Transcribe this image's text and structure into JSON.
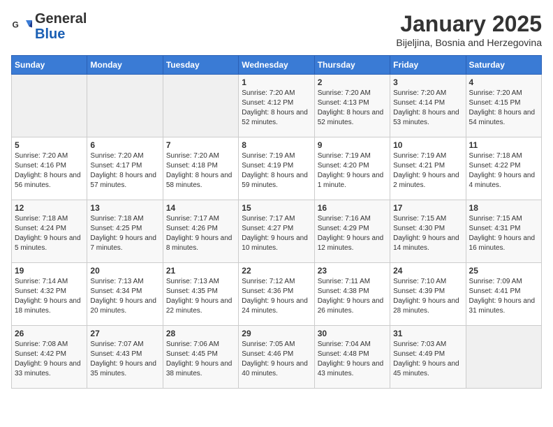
{
  "header": {
    "logo_general": "General",
    "logo_blue": "Blue",
    "month_title": "January 2025",
    "subtitle": "Bijeljina, Bosnia and Herzegovina"
  },
  "weekdays": [
    "Sunday",
    "Monday",
    "Tuesday",
    "Wednesday",
    "Thursday",
    "Friday",
    "Saturday"
  ],
  "weeks": [
    [
      {
        "day": "",
        "info": ""
      },
      {
        "day": "",
        "info": ""
      },
      {
        "day": "",
        "info": ""
      },
      {
        "day": "1",
        "info": "Sunrise: 7:20 AM\nSunset: 4:12 PM\nDaylight: 8 hours and 52 minutes."
      },
      {
        "day": "2",
        "info": "Sunrise: 7:20 AM\nSunset: 4:13 PM\nDaylight: 8 hours and 52 minutes."
      },
      {
        "day": "3",
        "info": "Sunrise: 7:20 AM\nSunset: 4:14 PM\nDaylight: 8 hours and 53 minutes."
      },
      {
        "day": "4",
        "info": "Sunrise: 7:20 AM\nSunset: 4:15 PM\nDaylight: 8 hours and 54 minutes."
      }
    ],
    [
      {
        "day": "5",
        "info": "Sunrise: 7:20 AM\nSunset: 4:16 PM\nDaylight: 8 hours and 56 minutes."
      },
      {
        "day": "6",
        "info": "Sunrise: 7:20 AM\nSunset: 4:17 PM\nDaylight: 8 hours and 57 minutes."
      },
      {
        "day": "7",
        "info": "Sunrise: 7:20 AM\nSunset: 4:18 PM\nDaylight: 8 hours and 58 minutes."
      },
      {
        "day": "8",
        "info": "Sunrise: 7:19 AM\nSunset: 4:19 PM\nDaylight: 8 hours and 59 minutes."
      },
      {
        "day": "9",
        "info": "Sunrise: 7:19 AM\nSunset: 4:20 PM\nDaylight: 9 hours and 1 minute."
      },
      {
        "day": "10",
        "info": "Sunrise: 7:19 AM\nSunset: 4:21 PM\nDaylight: 9 hours and 2 minutes."
      },
      {
        "day": "11",
        "info": "Sunrise: 7:18 AM\nSunset: 4:22 PM\nDaylight: 9 hours and 4 minutes."
      }
    ],
    [
      {
        "day": "12",
        "info": "Sunrise: 7:18 AM\nSunset: 4:24 PM\nDaylight: 9 hours and 5 minutes."
      },
      {
        "day": "13",
        "info": "Sunrise: 7:18 AM\nSunset: 4:25 PM\nDaylight: 9 hours and 7 minutes."
      },
      {
        "day": "14",
        "info": "Sunrise: 7:17 AM\nSunset: 4:26 PM\nDaylight: 9 hours and 8 minutes."
      },
      {
        "day": "15",
        "info": "Sunrise: 7:17 AM\nSunset: 4:27 PM\nDaylight: 9 hours and 10 minutes."
      },
      {
        "day": "16",
        "info": "Sunrise: 7:16 AM\nSunset: 4:29 PM\nDaylight: 9 hours and 12 minutes."
      },
      {
        "day": "17",
        "info": "Sunrise: 7:15 AM\nSunset: 4:30 PM\nDaylight: 9 hours and 14 minutes."
      },
      {
        "day": "18",
        "info": "Sunrise: 7:15 AM\nSunset: 4:31 PM\nDaylight: 9 hours and 16 minutes."
      }
    ],
    [
      {
        "day": "19",
        "info": "Sunrise: 7:14 AM\nSunset: 4:32 PM\nDaylight: 9 hours and 18 minutes."
      },
      {
        "day": "20",
        "info": "Sunrise: 7:13 AM\nSunset: 4:34 PM\nDaylight: 9 hours and 20 minutes."
      },
      {
        "day": "21",
        "info": "Sunrise: 7:13 AM\nSunset: 4:35 PM\nDaylight: 9 hours and 22 minutes."
      },
      {
        "day": "22",
        "info": "Sunrise: 7:12 AM\nSunset: 4:36 PM\nDaylight: 9 hours and 24 minutes."
      },
      {
        "day": "23",
        "info": "Sunrise: 7:11 AM\nSunset: 4:38 PM\nDaylight: 9 hours and 26 minutes."
      },
      {
        "day": "24",
        "info": "Sunrise: 7:10 AM\nSunset: 4:39 PM\nDaylight: 9 hours and 28 minutes."
      },
      {
        "day": "25",
        "info": "Sunrise: 7:09 AM\nSunset: 4:41 PM\nDaylight: 9 hours and 31 minutes."
      }
    ],
    [
      {
        "day": "26",
        "info": "Sunrise: 7:08 AM\nSunset: 4:42 PM\nDaylight: 9 hours and 33 minutes."
      },
      {
        "day": "27",
        "info": "Sunrise: 7:07 AM\nSunset: 4:43 PM\nDaylight: 9 hours and 35 minutes."
      },
      {
        "day": "28",
        "info": "Sunrise: 7:06 AM\nSunset: 4:45 PM\nDaylight: 9 hours and 38 minutes."
      },
      {
        "day": "29",
        "info": "Sunrise: 7:05 AM\nSunset: 4:46 PM\nDaylight: 9 hours and 40 minutes."
      },
      {
        "day": "30",
        "info": "Sunrise: 7:04 AM\nSunset: 4:48 PM\nDaylight: 9 hours and 43 minutes."
      },
      {
        "day": "31",
        "info": "Sunrise: 7:03 AM\nSunset: 4:49 PM\nDaylight: 9 hours and 45 minutes."
      },
      {
        "day": "",
        "info": ""
      }
    ]
  ]
}
